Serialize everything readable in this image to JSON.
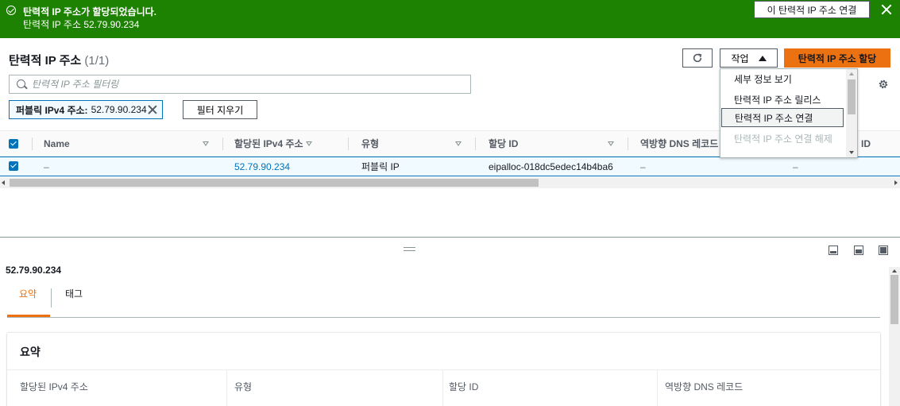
{
  "flash": {
    "title": "탄력적 IP 주소가 할당되었습니다.",
    "message": "탄력적 IP 주소 52.79.90.234",
    "action_label": "이 탄력적 IP 주소 연결",
    "color": "#1d8102"
  },
  "header": {
    "title": "탄력적 IP 주소",
    "count": "(1/1)",
    "actions_label": "작업",
    "allocate_label": "탄력적 IP 주소 할당"
  },
  "search": {
    "placeholder": "탄력적 IP 주소 필터링"
  },
  "filter": {
    "token_label": "퍼블릭 IPv4 주소:",
    "token_value": "52.79.90.234",
    "clear_label": "필터 지우기"
  },
  "table": {
    "columns": [
      "Name",
      "할당된 IPv4 주소",
      "유형",
      "할당 ID",
      "역방향 DNS 레코드",
      "ID"
    ],
    "rows": [
      {
        "name": "–",
        "ipv4": "52.79.90.234",
        "type": "퍼블릭 IP",
        "allocation_id": "eipalloc-018dc5edec14b4ba6",
        "reverse_dns": "–",
        "id": "–"
      }
    ]
  },
  "actions_menu": {
    "items": [
      "세부 정보 보기",
      "탄력적 IP 주소 릴리스",
      "탄력적 IP 주소 연결",
      "탄력적 IP 주소 연결 해제"
    ]
  },
  "detail": {
    "title": "52.79.90.234",
    "tabs": [
      "요약",
      "태그"
    ],
    "summary_title": "요약",
    "fields": [
      "할당된 IPv4 주소",
      "유형",
      "할당 ID",
      "역방향 DNS 레코드"
    ]
  },
  "colors": {
    "primary": "#ec7211",
    "link": "#0073bb",
    "success": "#1d8102"
  }
}
